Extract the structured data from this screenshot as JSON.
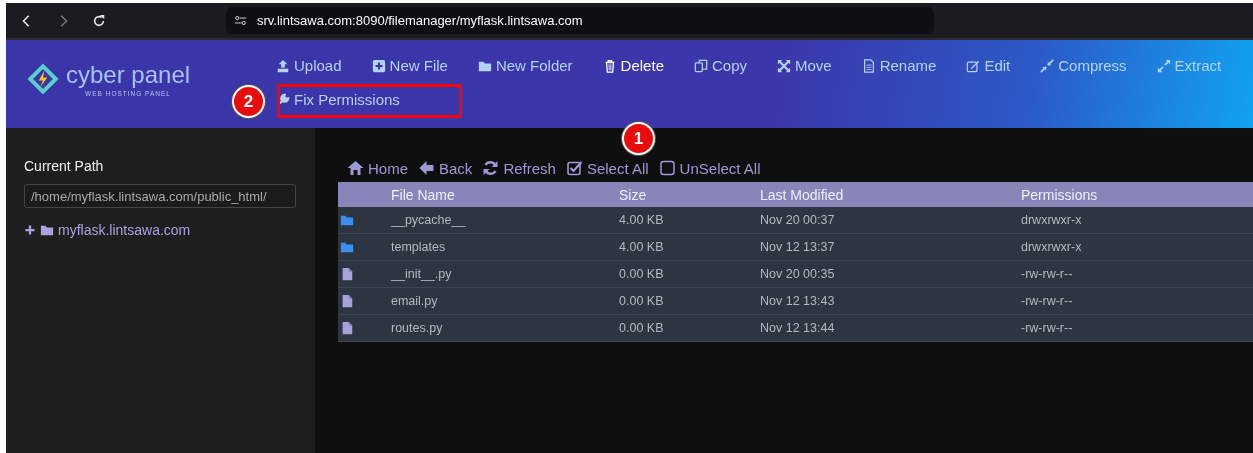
{
  "browser": {
    "url": "srv.lintsawa.com:8090/filemanager/myflask.lintsawa.com"
  },
  "logo": {
    "name": "cyber panel",
    "tagline": "WEB HOSTING PANEL"
  },
  "toolbar_rows": [
    [
      {
        "label": "Upload",
        "highlighted": false
      },
      {
        "label": "New File",
        "highlighted": false
      },
      {
        "label": "New Folder",
        "highlighted": false
      },
      {
        "label": "Delete",
        "highlighted": true
      },
      {
        "label": "Copy",
        "highlighted": false
      },
      {
        "label": "Move",
        "highlighted": false
      },
      {
        "label": "Rename",
        "highlighted": false
      },
      {
        "label": "Edit",
        "highlighted": false
      },
      {
        "label": "Compress",
        "highlighted": false
      },
      {
        "label": "Extract",
        "highlighted": false
      }
    ],
    [
      {
        "label": "Fix Permissions",
        "highlighted": false
      }
    ]
  ],
  "sidebar": {
    "title": "Current Path",
    "path": "/home/myflask.lintsawa.com/public_html/",
    "tree": [
      {
        "label": "myflask.lintsawa.com"
      }
    ]
  },
  "nav": [
    {
      "label": "Home"
    },
    {
      "label": "Back"
    },
    {
      "label": "Refresh"
    },
    {
      "label": "Select All"
    },
    {
      "label": "UnSelect All"
    }
  ],
  "table": {
    "columns": [
      "File Name",
      "Size",
      "Last Modified",
      "Permissions"
    ],
    "rows": [
      {
        "kind": "folder",
        "name": "__pycache__",
        "size": "4.00 KB",
        "modified": "Nov 20 00:37",
        "permissions": "drwxrwxr-x"
      },
      {
        "kind": "folder",
        "name": "templates",
        "size": "4.00 KB",
        "modified": "Nov 12 13:37",
        "permissions": "drwxrwxr-x"
      },
      {
        "kind": "file",
        "name": "__init__.py",
        "size": "0.00 KB",
        "modified": "Nov 20 00:35",
        "permissions": "-rw-rw-r--"
      },
      {
        "kind": "file",
        "name": "email.py",
        "size": "0.00 KB",
        "modified": "Nov 12 13:43",
        "permissions": "-rw-rw-r--"
      },
      {
        "kind": "file",
        "name": "routes.py",
        "size": "0.00 KB",
        "modified": "Nov 12 13:44",
        "permissions": "-rw-rw-r--"
      }
    ]
  },
  "annotations": [
    {
      "number": "1"
    },
    {
      "number": "2"
    }
  ]
}
